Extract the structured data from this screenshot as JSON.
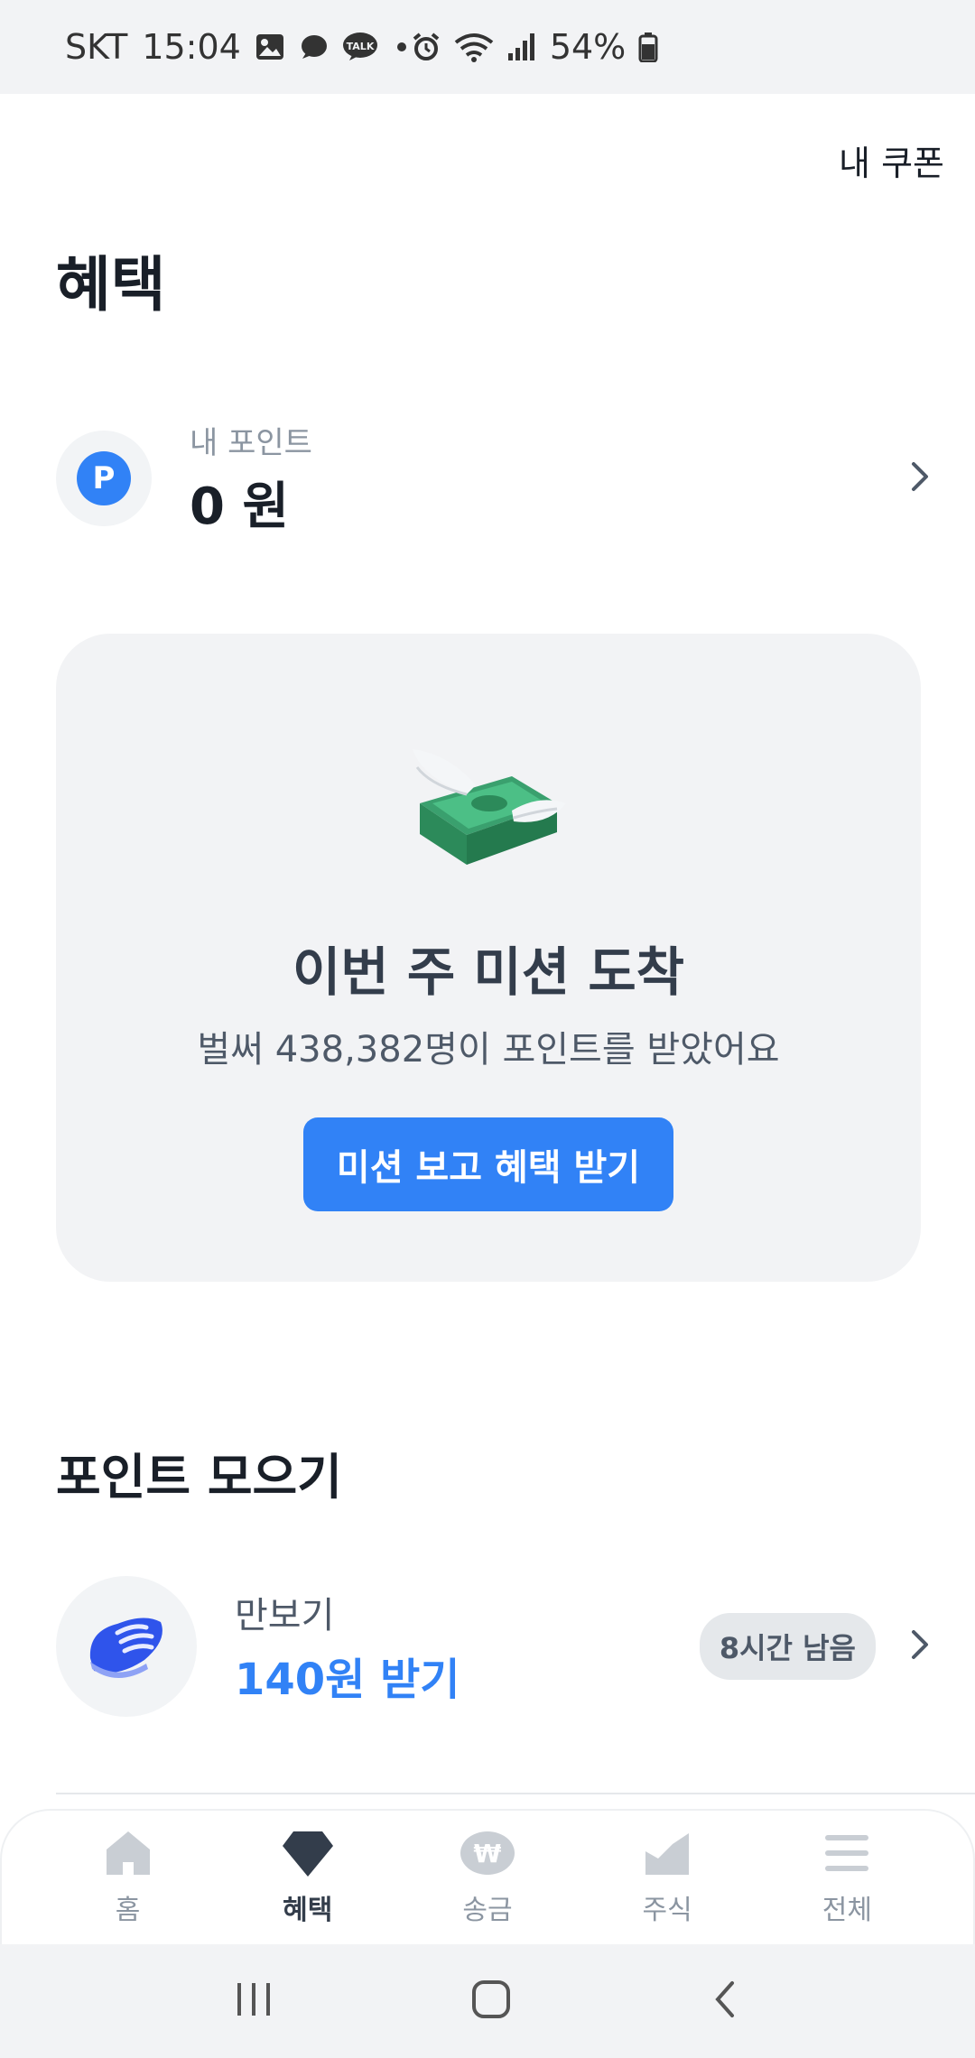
{
  "status_bar": {
    "carrier": "SKT",
    "time": "15:04",
    "battery": "54%"
  },
  "topbar": {
    "coupon_label": "내 쿠폰"
  },
  "page": {
    "title": "혜택"
  },
  "points": {
    "label": "내 포인트",
    "value": "0 원",
    "badge_letter": "P"
  },
  "mission": {
    "title": "이번 주 미션 도착",
    "subtitle": "벌써 438,382명이 포인트를 받았어요",
    "button_label": "미션 보고 혜택 받기"
  },
  "collect": {
    "section_title": "포인트 모으기",
    "items": [
      {
        "label": "만보기",
        "reward": "140원 받기",
        "badge": "8시간 남음"
      }
    ]
  },
  "tabs": [
    {
      "label": "홈",
      "icon": "home-icon",
      "active": false
    },
    {
      "label": "혜택",
      "icon": "benefit-gem-icon",
      "active": true
    },
    {
      "label": "송금",
      "icon": "won-transfer-icon",
      "active": false
    },
    {
      "label": "주식",
      "icon": "stock-chart-icon",
      "active": false
    },
    {
      "label": "전체",
      "icon": "menu-icon",
      "active": false
    }
  ],
  "colors": {
    "accent": "#3182f6",
    "card_bg": "#f2f3f5",
    "text_primary": "#191f28",
    "text_secondary": "#8b95a1"
  }
}
